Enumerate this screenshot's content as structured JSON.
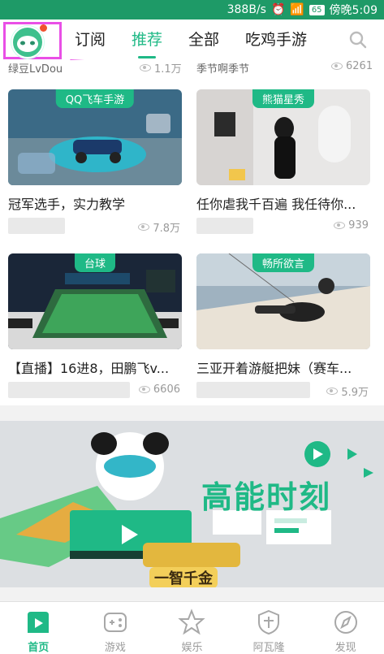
{
  "status_bar": {
    "speed": "388B/s",
    "battery": "65",
    "time": "傍晚5:09"
  },
  "header": {
    "tabs": [
      {
        "label": "订阅"
      },
      {
        "label": "推荐"
      },
      {
        "label": "全部"
      },
      {
        "label": "吃鸡手游"
      }
    ],
    "active_tab": "推荐"
  },
  "partial_row": {
    "left_title": "绿豆LvDou",
    "left_views": "1.1万",
    "right_title": "季节啊季节",
    "right_views": "6261"
  },
  "cards": [
    {
      "tag": "QQ飞车手游",
      "title": "冠军选手，实力教学",
      "views": "7.8万"
    },
    {
      "tag": "熊猫星秀",
      "title": "任你虐我千百遍 我任待你...",
      "views": "939"
    },
    {
      "tag": "台球",
      "title": "【直播】16进8，田鹏飞v...",
      "views": "6606"
    },
    {
      "tag": "畅所欲言",
      "title": "三亚开着游艇把妹（赛车...",
      "views": "5.9万"
    }
  ],
  "banner": {
    "title": "高能时刻",
    "badge": "一智千金"
  },
  "bottom_nav": [
    {
      "label": "首页",
      "icon": "home-play-icon"
    },
    {
      "label": "游戏",
      "icon": "gamepad-icon"
    },
    {
      "label": "娱乐",
      "icon": "star-icon"
    },
    {
      "label": "阿瓦隆",
      "icon": "shield-icon"
    },
    {
      "label": "发现",
      "icon": "compass-icon"
    }
  ],
  "colors": {
    "accent": "#1fb986",
    "status_bar": "#1e9a67",
    "highlight": "#e94fe6"
  }
}
